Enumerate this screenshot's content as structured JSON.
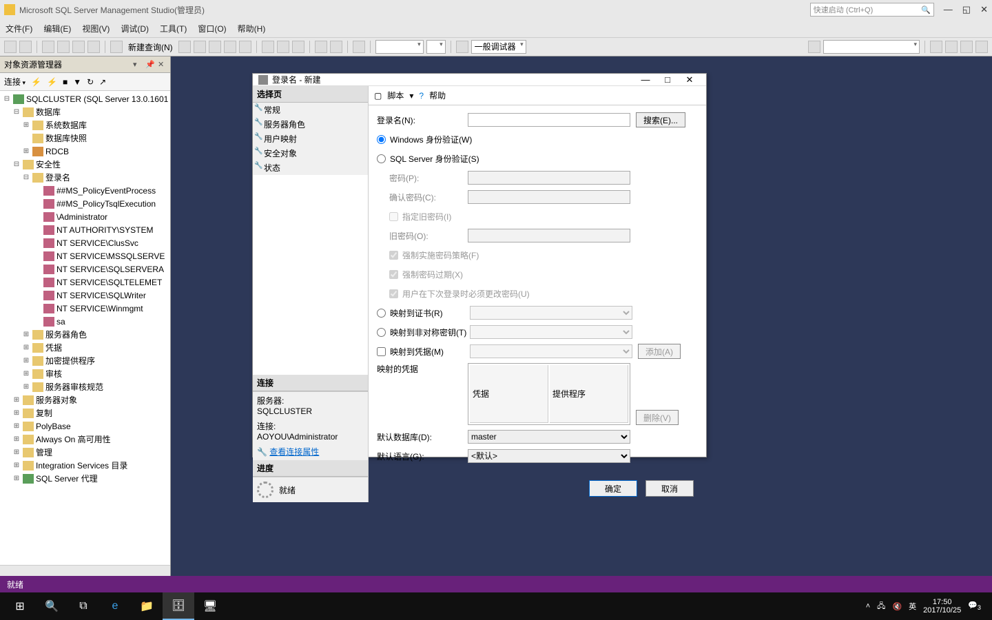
{
  "app": {
    "title": "Microsoft SQL Server Management Studio(管理员)",
    "quick_launch_placeholder": "快速启动 (Ctrl+Q)"
  },
  "menu": {
    "file": "文件(F)",
    "edit": "编辑(E)",
    "view": "视图(V)",
    "debug": "调试(D)",
    "tools": "工具(T)",
    "window": "窗口(O)",
    "help": "帮助(H)"
  },
  "toolbar": {
    "new_query": "新建查询(N)",
    "debugger": "一般调试器"
  },
  "obj_explorer": {
    "title": "对象资源管理器",
    "connect": "连接"
  },
  "tree": {
    "root": "SQLCLUSTER (SQL Server 13.0.1601",
    "databases": "数据库",
    "system_db": "系统数据库",
    "db_snapshots": "数据库快照",
    "rdcb": "RDCB",
    "security": "安全性",
    "logins": "登录名",
    "login_items": [
      "##MS_PolicyEventProcess",
      "##MS_PolicyTsqlExecution",
      "          \\Administrator",
      "NT AUTHORITY\\SYSTEM",
      "NT SERVICE\\ClusSvc",
      "NT SERVICE\\MSSQLSERVE",
      "NT SERVICE\\SQLSERVERA",
      "NT SERVICE\\SQLTELEMET",
      "NT SERVICE\\SQLWriter",
      "NT SERVICE\\Winmgmt",
      "sa"
    ],
    "server_roles": "服务器角色",
    "credentials": "凭据",
    "crypto_providers": "加密提供程序",
    "audits": "审核",
    "server_audit_spec": "服务器审核规范",
    "server_objects": "服务器对象",
    "replication": "复制",
    "polybase": "PolyBase",
    "alwayson": "Always On 高可用性",
    "management": "管理",
    "is_catalog": "Integration Services 目录",
    "agent": "SQL Server 代理"
  },
  "dialog": {
    "title": "登录名 - 新建",
    "script": "脚本",
    "help": "帮助",
    "pages_header": "选择页",
    "pages": {
      "general": "常规",
      "server_roles": "服务器角色",
      "user_mapping": "用户映射",
      "securables": "安全对象",
      "status": "状态"
    },
    "connection_header": "连接",
    "server_label": "服务器:",
    "server_value": "SQLCLUSTER",
    "conn_label": "连接:",
    "conn_value": "AOYOU\\Administrator",
    "view_conn_props": "查看连接属性",
    "progress_header": "进度",
    "progress_value": "就绪",
    "form": {
      "login_name": "登录名(N):",
      "search": "搜索(E)...",
      "windows_auth": "Windows 身份验证(W)",
      "sql_auth": "SQL Server 身份验证(S)",
      "password": "密码(P):",
      "confirm_password": "确认密码(C):",
      "specify_old_password": "指定旧密码(I)",
      "old_password": "旧密码(O):",
      "enforce_policy": "强制实施密码策略(F)",
      "enforce_expiration": "强制密码过期(X)",
      "must_change": "用户在下次登录时必须更改密码(U)",
      "map_cert": "映射到证书(R)",
      "map_asym_key": "映射到非对称密钥(T)",
      "map_cred": "映射到凭据(M)",
      "mapped_creds": "映射的凭据",
      "add": "添加(A)",
      "remove": "删除(V)",
      "cred_col": "凭据",
      "provider_col": "提供程序",
      "default_db": "默认数据库(D):",
      "default_db_value": "master",
      "default_lang": "默认语言(G):",
      "default_lang_value": "<默认>"
    },
    "ok": "确定",
    "cancel": "取消"
  },
  "status": {
    "ready": "就绪"
  },
  "taskbar": {
    "ime": "英",
    "time": "17:50",
    "date": "2017/10/25",
    "notif_count": "3"
  }
}
